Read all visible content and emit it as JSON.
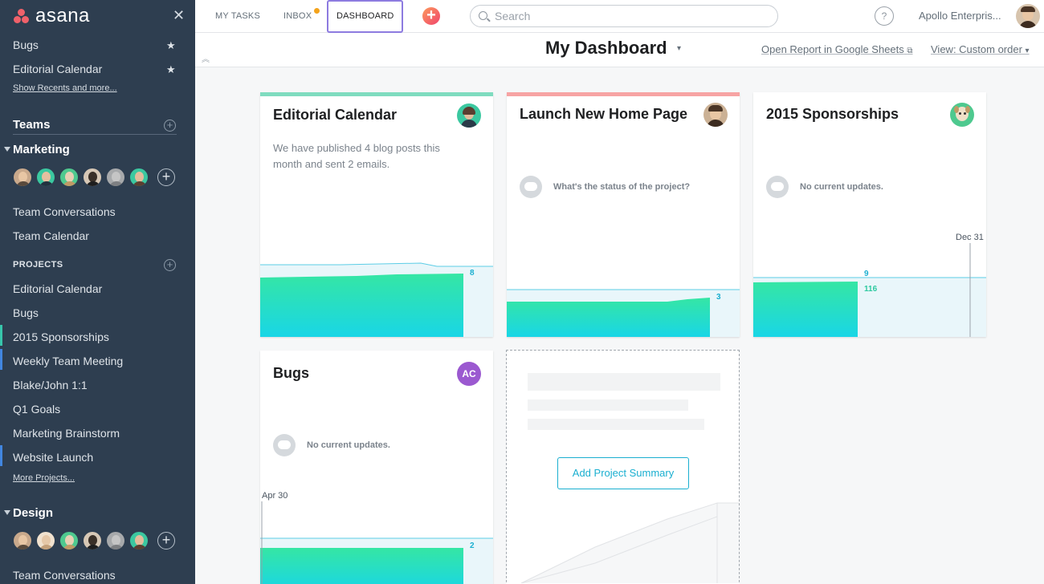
{
  "app": {
    "logo_text": "asana",
    "brand_color": "#f0616a"
  },
  "sidebar": {
    "favorites": [
      {
        "label": "Bugs"
      },
      {
        "label": "Editorial Calendar"
      }
    ],
    "show_recents": "Show Recents and more...",
    "teams_heading": "Teams",
    "marketing": {
      "name": "Marketing",
      "links": [
        "Team Conversations",
        "Team Calendar"
      ],
      "projects_heading": "PROJECTS",
      "projects": [
        {
          "label": "Editorial Calendar",
          "color": ""
        },
        {
          "label": "Bugs",
          "color": ""
        },
        {
          "label": "2015 Sponsorships",
          "color": "#37c5ab"
        },
        {
          "label": "Weekly Team Meeting",
          "color": "#4186e0"
        },
        {
          "label": "Blake/John 1:1",
          "color": ""
        },
        {
          "label": "Q1 Goals",
          "color": ""
        },
        {
          "label": "Marketing Brainstorm",
          "color": ""
        },
        {
          "label": "Website Launch",
          "color": "#4186e0"
        }
      ],
      "more_projects": "More Projects..."
    },
    "design": {
      "name": "Design",
      "links": [
        "Team Conversations"
      ]
    }
  },
  "topbar": {
    "tabs": {
      "my_tasks": "MY TASKS",
      "inbox": "INBOX",
      "dashboard": "DASHBOARD"
    },
    "search_placeholder": "Search",
    "help_label": "?",
    "org_name": "Apollo Enterpris..."
  },
  "dashboard": {
    "title": "My Dashboard",
    "open_report": "Open Report in Google Sheets",
    "view_order": "View: Custom order"
  },
  "cards": [
    {
      "title": "Editorial Calendar",
      "color": "#7fdcbf",
      "description": "We have published 4 blog posts this month and sent 2 emails.",
      "chart_value": "8"
    },
    {
      "title": "Launch New Home Page",
      "color": "#f7a4a4",
      "status": "What's the status of the project?",
      "chart_value": "3"
    },
    {
      "title": "2015 Sponsorships",
      "color": "",
      "status": "No current updates.",
      "chart_value_top": "9",
      "chart_value_bottom": "116",
      "chart_date": "Dec 31"
    },
    {
      "title": "Bugs",
      "color": "",
      "avatar_initials": "AC",
      "status": "No current updates.",
      "chart_value": "2",
      "chart_date": "Apr 30"
    }
  ],
  "add_project_summary": "Add Project Summary"
}
